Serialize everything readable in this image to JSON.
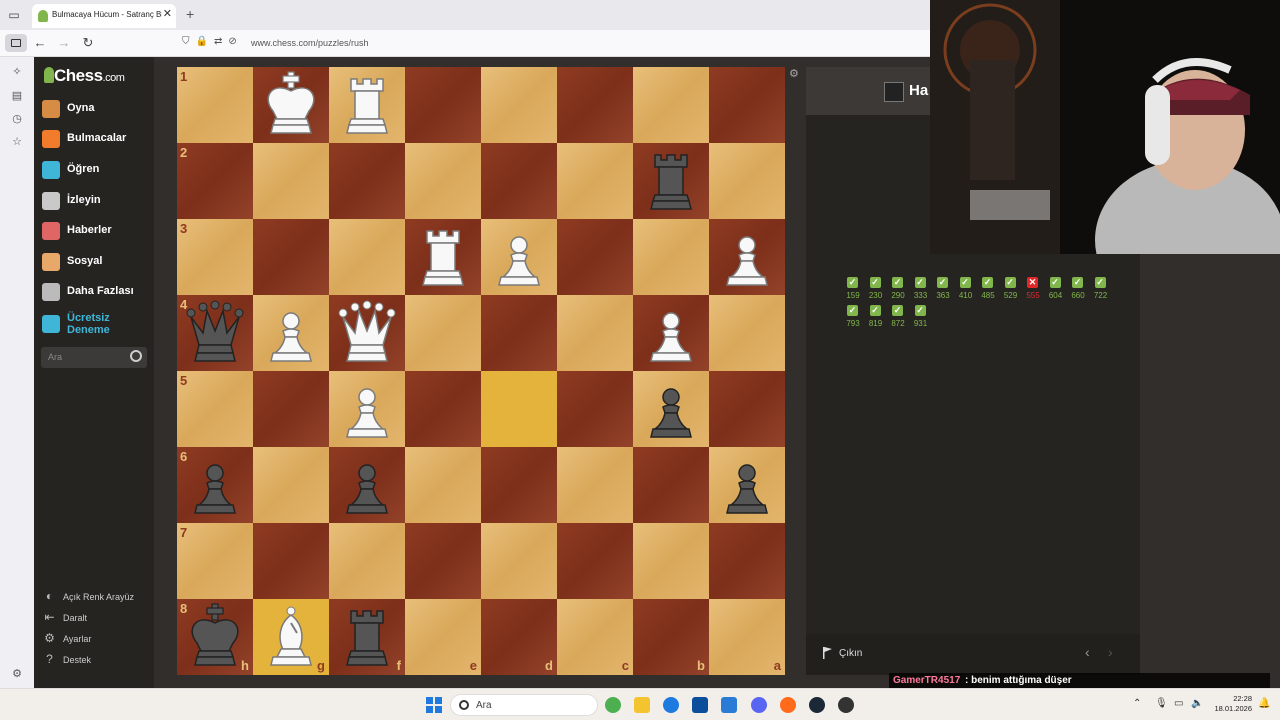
{
  "browser": {
    "tab_title": "Bulmacaya Hücum - Satranç Bulmacaları",
    "url": "www.chess.com/puzzles/rush"
  },
  "sidebar": {
    "logo_main": "Chess",
    "logo_suffix": ".com",
    "items": [
      {
        "label": "Oyna",
        "icon": "play-icon",
        "color": "#d68c45"
      },
      {
        "label": "Bulmacalar",
        "icon": "puzzle-icon",
        "color": "#f27c2b"
      },
      {
        "label": "Öğren",
        "icon": "learn-icon",
        "color": "#3fb6d8"
      },
      {
        "label": "İzleyin",
        "icon": "binoculars-icon",
        "color": "#c9c9c9"
      },
      {
        "label": "Haberler",
        "icon": "news-icon",
        "color": "#e06666"
      },
      {
        "label": "Sosyal",
        "icon": "social-icon",
        "color": "#e8a86a"
      },
      {
        "label": "Daha Fazlası",
        "icon": "more-icon",
        "color": "#bbbbbb"
      },
      {
        "label": "Ücretsiz Deneme",
        "icon": "diamond-icon",
        "color": "#3fb6d8"
      }
    ],
    "search_placeholder": "Ara",
    "bottom": [
      {
        "label": "Açık Renk Arayüz",
        "icon": "theme-icon"
      },
      {
        "label": "Daralt",
        "icon": "collapse-icon"
      },
      {
        "label": "Ayarlar",
        "icon": "gear-icon"
      },
      {
        "label": "Destek",
        "icon": "help-icon"
      }
    ]
  },
  "board": {
    "ranks": [
      "1",
      "2",
      "3",
      "4",
      "5",
      "6",
      "7",
      "8"
    ],
    "files": [
      "h",
      "g",
      "f",
      "e",
      "d",
      "c",
      "b",
      "a"
    ],
    "highlight": [
      [
        4,
        4
      ],
      [
        7,
        1
      ]
    ],
    "pieces": [
      {
        "row": 0,
        "col": 1,
        "p": "K",
        "c": "w"
      },
      {
        "row": 0,
        "col": 2,
        "p": "R",
        "c": "w"
      },
      {
        "row": 1,
        "col": 6,
        "p": "R",
        "c": "b"
      },
      {
        "row": 2,
        "col": 3,
        "p": "R",
        "c": "w"
      },
      {
        "row": 2,
        "col": 4,
        "p": "P",
        "c": "w"
      },
      {
        "row": 2,
        "col": 7,
        "p": "P",
        "c": "w"
      },
      {
        "row": 3,
        "col": 0,
        "p": "Q",
        "c": "b"
      },
      {
        "row": 3,
        "col": 1,
        "p": "P",
        "c": "w"
      },
      {
        "row": 3,
        "col": 2,
        "p": "Q",
        "c": "w"
      },
      {
        "row": 3,
        "col": 6,
        "p": "P",
        "c": "w"
      },
      {
        "row": 4,
        "col": 2,
        "p": "P",
        "c": "w"
      },
      {
        "row": 4,
        "col": 6,
        "p": "P",
        "c": "b"
      },
      {
        "row": 5,
        "col": 0,
        "p": "P",
        "c": "b"
      },
      {
        "row": 5,
        "col": 2,
        "p": "P",
        "c": "b"
      },
      {
        "row": 5,
        "col": 7,
        "p": "P",
        "c": "b"
      },
      {
        "row": 7,
        "col": 0,
        "p": "K",
        "c": "b"
      },
      {
        "row": 7,
        "col": 1,
        "p": "B",
        "c": "w"
      },
      {
        "row": 7,
        "col": 2,
        "p": "R",
        "c": "b"
      }
    ]
  },
  "panel": {
    "title": "Ha",
    "results": [
      {
        "score": "159",
        "ok": true
      },
      {
        "score": "230",
        "ok": true
      },
      {
        "score": "290",
        "ok": true
      },
      {
        "score": "333",
        "ok": true
      },
      {
        "score": "363",
        "ok": true
      },
      {
        "score": "410",
        "ok": true
      },
      {
        "score": "485",
        "ok": true
      },
      {
        "score": "529",
        "ok": true
      },
      {
        "score": "555",
        "ok": false
      },
      {
        "score": "604",
        "ok": true
      },
      {
        "score": "660",
        "ok": true
      },
      {
        "score": "722",
        "ok": true
      },
      {
        "score": "793",
        "ok": true
      },
      {
        "score": "819",
        "ok": true
      },
      {
        "score": "872",
        "ok": true
      },
      {
        "score": "931",
        "ok": true
      }
    ],
    "exit_label": "Çıkın"
  },
  "chat": {
    "user": "GamerTR4517",
    "message": ": benim attığıma düşer"
  },
  "taskbar": {
    "search": "Ara",
    "time": "22:28",
    "date": "18.01.2026"
  }
}
